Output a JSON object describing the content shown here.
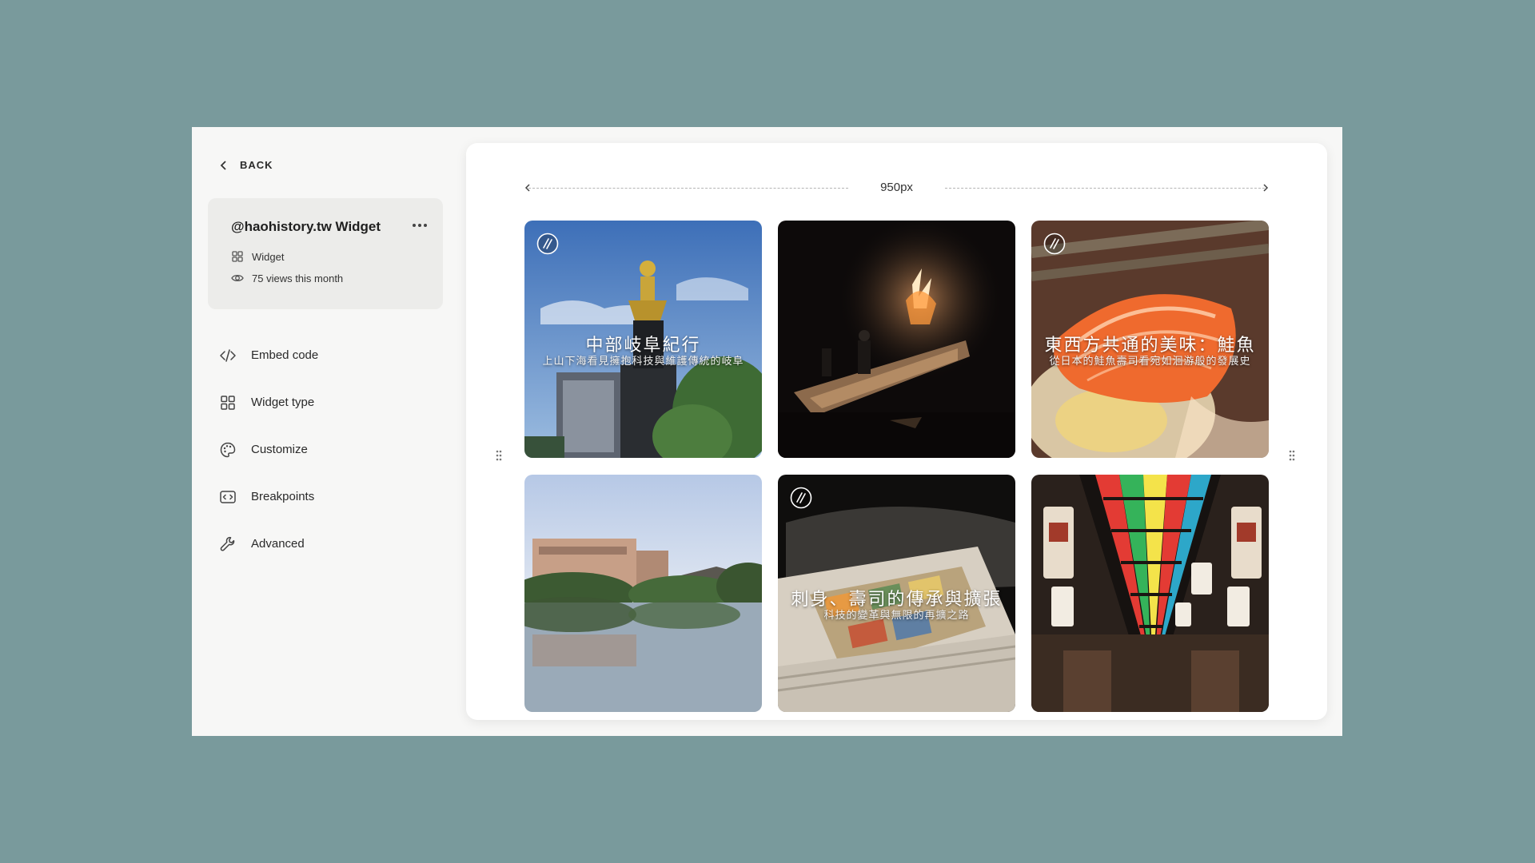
{
  "sidebar": {
    "back_label": "BACK",
    "widget": {
      "title": "@haohistory.tw Widget",
      "type_label": "Widget",
      "views_label": "75 views this month"
    },
    "menu": [
      {
        "label": "Embed code",
        "icon": "code-icon"
      },
      {
        "label": "Widget type",
        "icon": "grid-icon"
      },
      {
        "label": "Customize",
        "icon": "palette-icon"
      },
      {
        "label": "Breakpoints",
        "icon": "breakpoints-icon"
      },
      {
        "label": "Advanced",
        "icon": "wrench-icon"
      }
    ]
  },
  "preview": {
    "width_label": "950px",
    "tiles": [
      {
        "title": "中部岐阜紀行",
        "subtitle": "上山下海看見擁抱科技與維護傳統的岐阜",
        "has_icon": true
      },
      {
        "title": "",
        "subtitle": "",
        "has_icon": false
      },
      {
        "title": "東西方共通的美味：鮭魚",
        "subtitle": "從日本的鮭魚壽司看宛如洄游般的發展史",
        "has_icon": true
      },
      {
        "title": "",
        "subtitle": "",
        "has_icon": false
      },
      {
        "title": "刺身、壽司的傳承與擴張",
        "subtitle": "科技的變革與無限的再擴之路",
        "has_icon": true
      },
      {
        "title": "",
        "subtitle": "",
        "has_icon": false
      }
    ]
  },
  "colors": {
    "background": "#799a9c",
    "app_bg": "#f7f7f6",
    "card_bg": "#ececea"
  }
}
